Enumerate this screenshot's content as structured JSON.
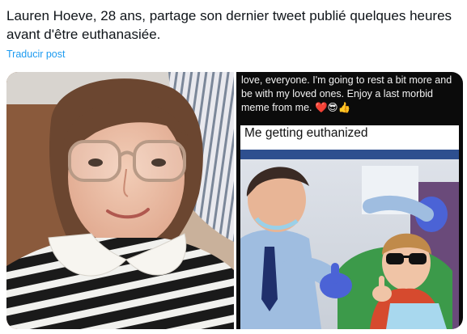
{
  "post": {
    "text": "Lauren Hoeve, 28 ans, partage son dernier tweet publié quelques heures avant d'être euthanasiée.",
    "translate_link": "Traducir post"
  },
  "media": {
    "left_photo": {
      "subject": "selfie of young woman with glasses and striped shirt"
    },
    "right_screenshot": {
      "tweet_text": "love, everyone. I'm going to rest a bit more and be with my loved ones. Enjoy a last morbid meme from me. ❤️😎👍",
      "meme_caption": "Me getting euthanized",
      "meme_subject": "dentist giving thumbs up next to child in sunglasses"
    }
  },
  "colors": {
    "text": "#0f1419",
    "link": "#1d9bf0",
    "tweet_bg": "#0b0b0b"
  }
}
